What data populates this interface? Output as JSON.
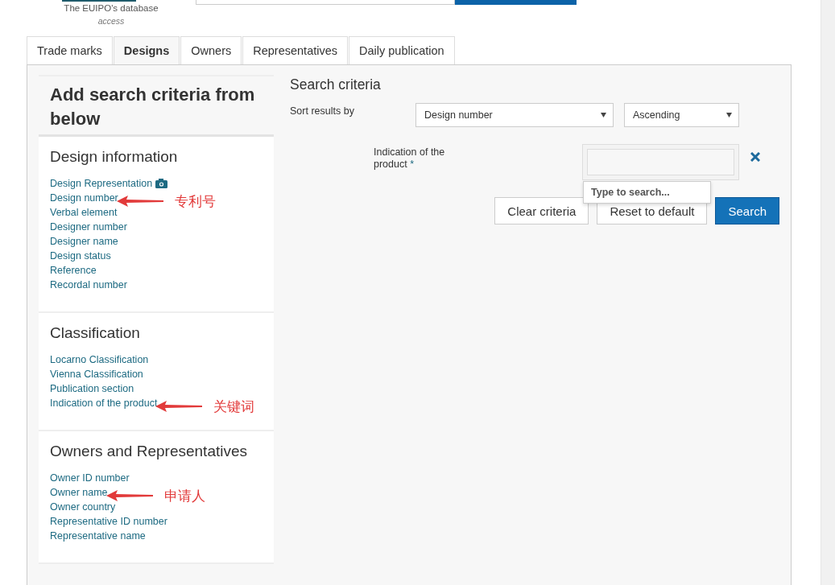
{
  "header": {
    "tagline": "The EUIPO's database",
    "tagline_2": "access"
  },
  "tabs": [
    {
      "label": "Trade marks",
      "selected": false
    },
    {
      "label": "Designs",
      "selected": true
    },
    {
      "label": "Owners",
      "selected": false
    },
    {
      "label": "Representatives",
      "selected": false
    },
    {
      "label": "Daily publication",
      "selected": false
    }
  ],
  "sidebar": {
    "title": "Add search criteria from below",
    "sections": [
      {
        "title": "Design information",
        "items": [
          {
            "label": "Design Representation",
            "kind": "camera"
          },
          {
            "label": "Design number",
            "annotation": "专利号"
          },
          {
            "label": "Verbal element"
          },
          {
            "label": "Designer number"
          },
          {
            "label": "Designer name"
          },
          {
            "label": "Design status"
          },
          {
            "label": "Reference"
          },
          {
            "label": "Recordal number"
          }
        ]
      },
      {
        "title": "Classification",
        "items": [
          {
            "label": "Locarno Classification"
          },
          {
            "label": "Vienna Classification"
          },
          {
            "label": "Publication section"
          },
          {
            "label": "Indication of the product",
            "annotation": "关键词"
          }
        ]
      },
      {
        "title": "Owners and Representatives",
        "items": [
          {
            "label": "Owner ID number"
          },
          {
            "label": "Owner name",
            "annotation": "申请人"
          },
          {
            "label": "Owner country"
          },
          {
            "label": "Representative ID number"
          },
          {
            "label": "Representative name"
          }
        ]
      }
    ]
  },
  "criteria": {
    "title": "Search criteria",
    "sort_label": "Sort results by",
    "sort_field": "Design number",
    "sort_order": "Ascending",
    "field_label": "Indication of the product",
    "required_mark": "*",
    "dropdown_hint": "Type to search...",
    "buttons": [
      {
        "label": "Clear criteria",
        "kind": "default"
      },
      {
        "label": "Reset to default",
        "kind": "default"
      },
      {
        "label": "Search",
        "kind": "primary"
      }
    ]
  }
}
